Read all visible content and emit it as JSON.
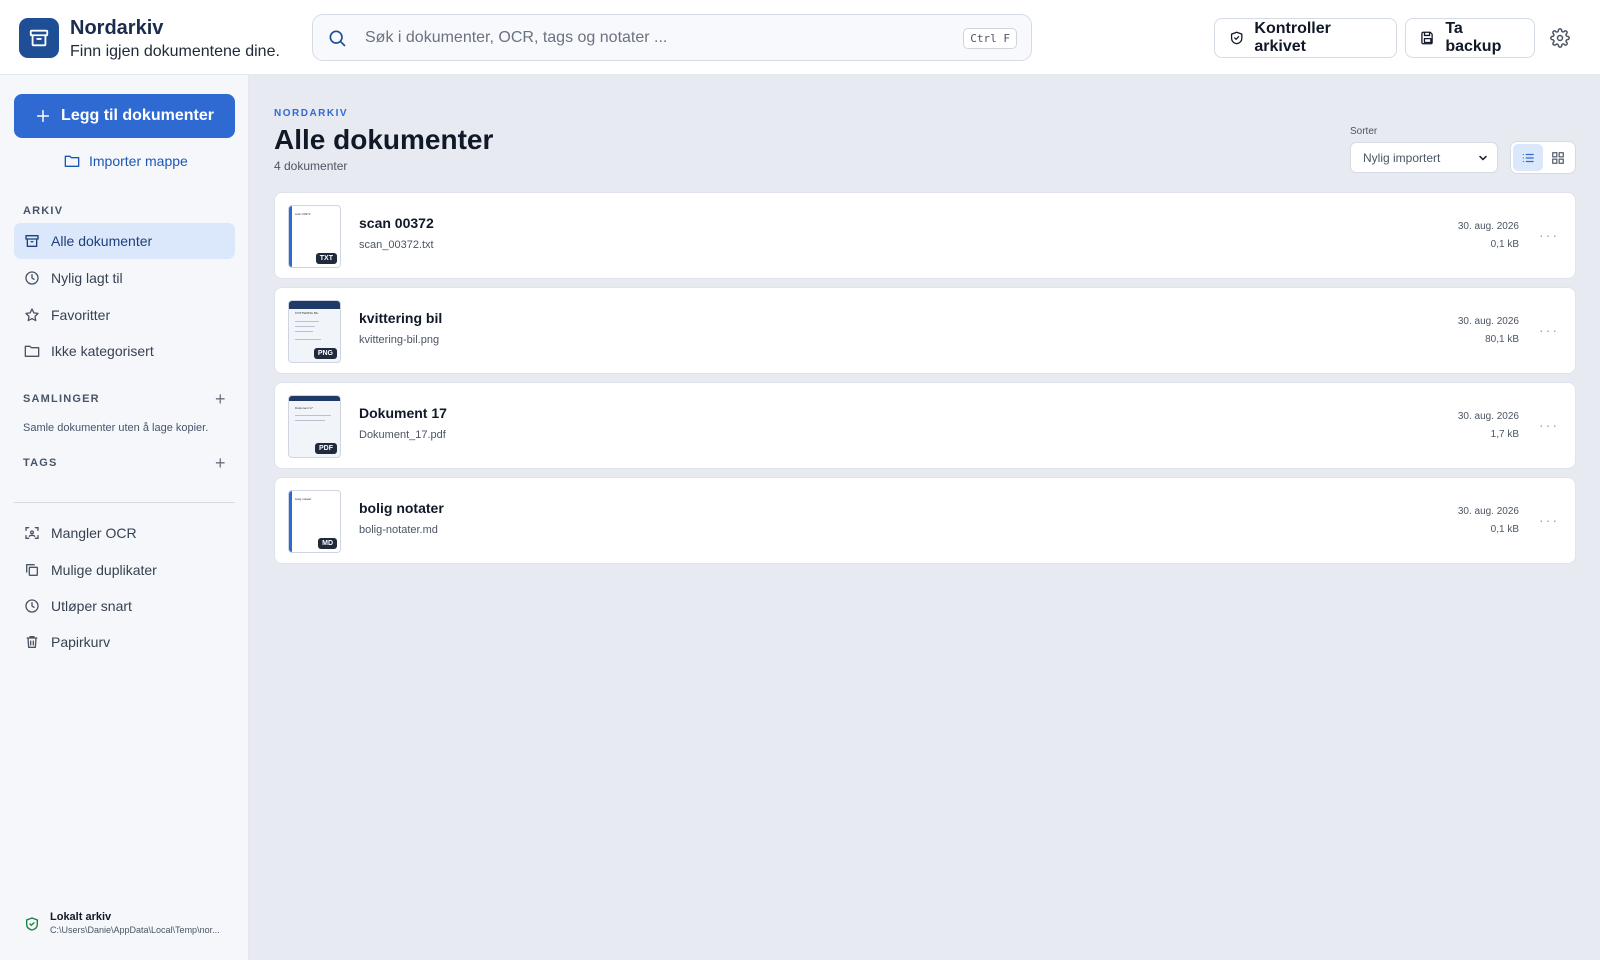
{
  "app": {
    "name": "Nordarkiv",
    "tagline": "Finn igjen dokumentene dine."
  },
  "search": {
    "placeholder": "Søk i dokumenter, OCR, tags og notater ...",
    "shortcut": "Ctrl F"
  },
  "header": {
    "check_label": "Kontroller arkivet",
    "backup_label": "Ta backup"
  },
  "sidebar": {
    "add_label": "Legg til dokumenter",
    "import_label": "Importer mappe",
    "archive_heading": "ARKIV",
    "archive_items": [
      {
        "label": "Alle dokumenter",
        "icon": "archive-icon",
        "active": true
      },
      {
        "label": "Nylig lagt til",
        "icon": "clock-icon"
      },
      {
        "label": "Favoritter",
        "icon": "star-icon"
      },
      {
        "label": "Ikke kategorisert",
        "icon": "folder-icon"
      }
    ],
    "collections_heading": "SAMLINGER",
    "collections_desc": "Samle dokumenter uten å lage kopier.",
    "tags_heading": "TAGS",
    "tool_items": [
      {
        "label": "Mangler OCR",
        "icon": "scan-icon"
      },
      {
        "label": "Mulige duplikater",
        "icon": "copy-icon"
      },
      {
        "label": "Utløper snart",
        "icon": "clock-icon"
      },
      {
        "label": "Papirkurv",
        "icon": "trash-icon"
      }
    ],
    "footer_title": "Lokalt arkiv",
    "footer_path": "C:\\Users\\Danie\\AppData\\Local\\Temp\\nor..."
  },
  "main": {
    "eyebrow": "NORDARKIV",
    "title": "Alle dokumenter",
    "count": "4 dokumenter",
    "sort_label": "Sorter",
    "sort_value": "Nylig importert"
  },
  "documents": [
    {
      "name": "scan 00372",
      "file": "scan_00372.txt",
      "date": "30. aug. 2026",
      "size": "0,1 kB",
      "type": "TXT",
      "thumb_text": "scan 00372"
    },
    {
      "name": "kvittering bil",
      "file": "kvittering-bil.png",
      "date": "30. aug. 2026",
      "size": "80,1 kB",
      "type": "PNG",
      "thumb_text": "KVITTERING BIL"
    },
    {
      "name": "Dokument 17",
      "file": "Dokument_17.pdf",
      "date": "30. aug. 2026",
      "size": "1,7 kB",
      "type": "PDF",
      "thumb_text": "Dokument 17"
    },
    {
      "name": "bolig notater",
      "file": "bolig-notater.md",
      "date": "30. aug. 2026",
      "size": "0,1 kB",
      "type": "MD",
      "thumb_text": "bolig notater"
    }
  ],
  "colors": {
    "accent": "#2f6ad2",
    "brand": "#1e4e96",
    "active_bg": "#dbe8fb",
    "footer_icon": "#15803d"
  }
}
